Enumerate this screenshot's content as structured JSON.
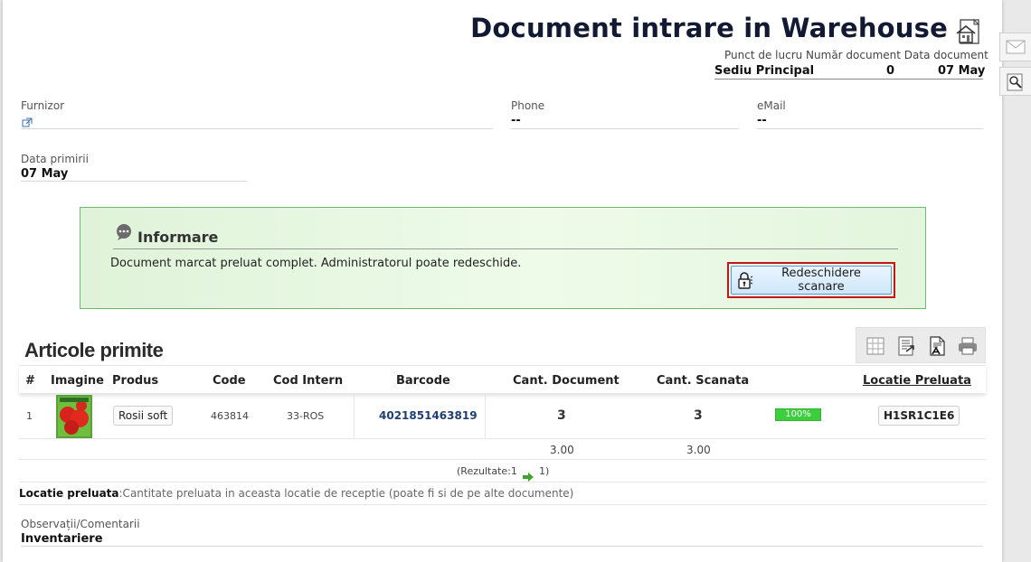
{
  "header": {
    "title": "Document intrare in Warehouse",
    "meta_labels": "Punct de lucru Număr document Data document",
    "work_point": "Sediu Principal",
    "doc_number": "0",
    "doc_date": "07 May"
  },
  "fields": {
    "supplier_label": "Furnizor",
    "phone_label": "Phone",
    "phone_value": "--",
    "email_label": "eMail",
    "email_value": "--",
    "received_label": "Data primirii",
    "received_value": "07 May"
  },
  "info": {
    "title": "Informare",
    "message": "Document marcat preluat complet. Administratorul poate redeschide.",
    "reopen_button": "Redeschidere scanare"
  },
  "items": {
    "title": "Articole primite",
    "columns": [
      "#",
      "Imagine",
      "Produs",
      "Code",
      "Cod Intern",
      "Barcode",
      "Cant. Document",
      "Cant. Scanata",
      "Locatie Preluata"
    ],
    "rows": [
      {
        "index": "1",
        "product": "Rosii soft",
        "code": "463814",
        "internal_code": "33-ROS",
        "barcode": "4021851463819",
        "qty_document": "3",
        "qty_scanned": "3",
        "progress": "100%",
        "location": "H1SR1C1E6"
      }
    ],
    "totals": {
      "qty_document": "3.00",
      "qty_scanned": "3.00"
    },
    "pager_left": "(Rezultate:1",
    "pager_right": "1)"
  },
  "legend": {
    "label": "Locatie preluata",
    "text": ":Cantitate preluata in aceasta locatie de receptie (poate fi si de pe alte documente)"
  },
  "notes": {
    "label": "Observații/Comentarii",
    "value": "Inventariere"
  },
  "colors": {
    "title": "#121a33",
    "info_border": "#6fb86f",
    "highlight": "#c8151b",
    "progress": "#3cce3c",
    "link": "#1f3f73"
  },
  "icons": [
    "house-document-icon",
    "mail-icon",
    "search-icon",
    "external-link-icon",
    "chat-bubble-icon",
    "lock-icon",
    "table-icon",
    "export-list-icon",
    "pdf-icon",
    "print-icon",
    "arrow-right-icon",
    "product-image"
  ]
}
